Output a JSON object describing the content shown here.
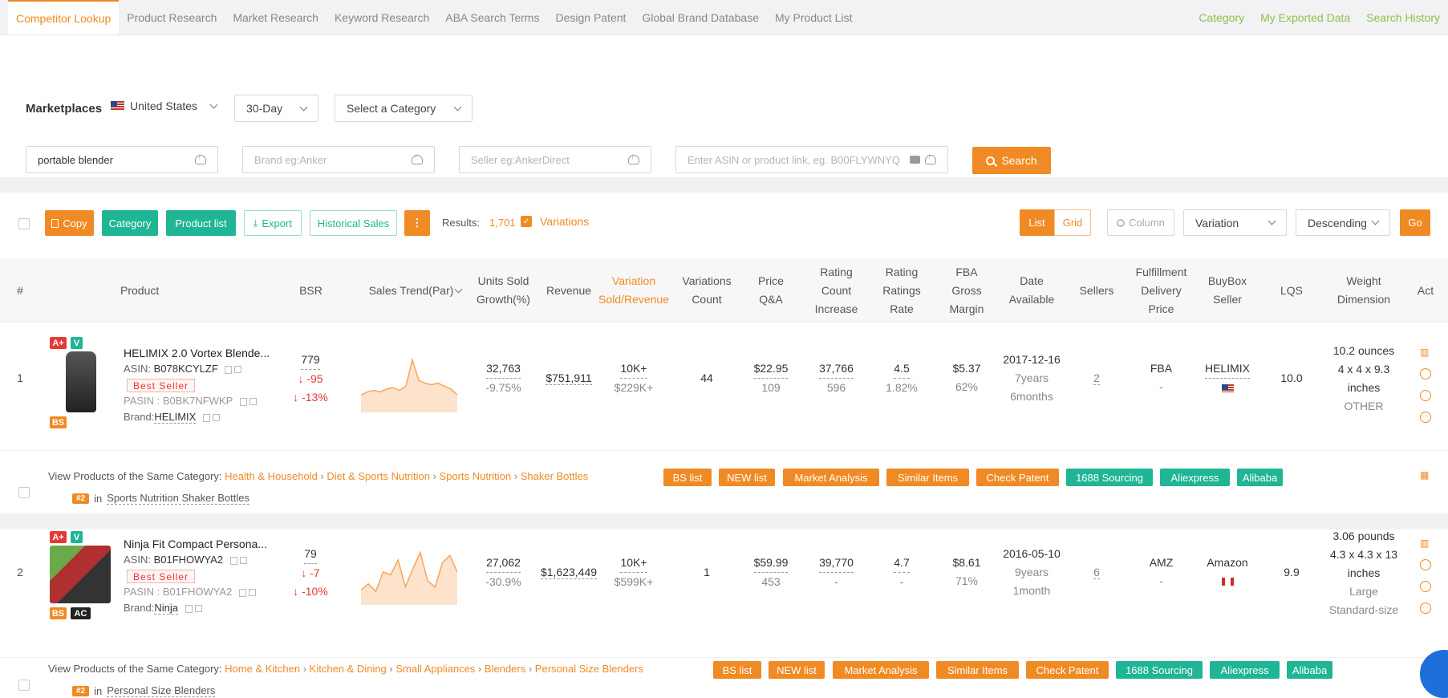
{
  "nav": {
    "tabs": [
      "Competitor Lookup",
      "Product Research",
      "Market Research",
      "Keyword Research",
      "ABA Search Terms",
      "Design Patent",
      "Global Brand Database",
      "My Product List"
    ],
    "right_tabs": [
      "Category",
      "My Exported Data",
      "Search History"
    ]
  },
  "search": {
    "marketplaces_label": "Marketplaces",
    "marketplace": "United States",
    "period": "30-Day",
    "category_placeholder": "Select a Category",
    "keyword_value": "portable blender",
    "brand_placeholder": "Brand eg:Anker",
    "seller_placeholder": "Seller eg:AnkerDirect",
    "asin_placeholder": "Enter ASIN or product link, eg. B00FLYWNYQ",
    "search_button": "Search"
  },
  "toolbar": {
    "copy": "Copy",
    "category": "Category",
    "product_list": "Product list",
    "export": "Export",
    "historical_sales": "Historical Sales",
    "results_label": "Results:",
    "results_count": "1,701",
    "variations": "Variations",
    "view_list": "List",
    "view_grid": "Grid",
    "column": "Column",
    "sort_field": "Variation",
    "sort_order": "Descending",
    "go": "Go"
  },
  "headers": {
    "idx": "#",
    "product": "Product",
    "bsr": "BSR",
    "sales_trend": "Sales Trend(Par)",
    "units": "Units Sold Growth(%)",
    "revenue": "Revenue",
    "variation": "Variation Sold/Revenue",
    "var_count": "Variations Count",
    "price": "Price Q&A",
    "rating_count": "Rating Count Increase",
    "rating": "Rating Ratings Rate",
    "fba": "FBA Gross Margin",
    "date": "Date Available",
    "sellers": "Sellers",
    "fulfillment": "Fulfillment Delivery Price",
    "buybox": "BuyBox Seller",
    "lqs": "LQS",
    "weight": "Weight Dimension",
    "act": "Act"
  },
  "rows": [
    {
      "idx": "1",
      "name": "HELIMIX 2.0 Vortex Blende...",
      "asin_label": "ASIN:",
      "asin": "B078KCYLZF",
      "best_seller": "Best Seller",
      "pasin": "PASIN : B0BK7NFWKP",
      "brand_label": "Brand:",
      "brand": "HELIMIX",
      "badges": [
        "A+",
        "V",
        "BS"
      ],
      "bsr": "779",
      "bsr_change": "↓ -95",
      "bsr_pct": "↓ -13%",
      "trend": [
        12,
        14,
        15,
        14,
        16,
        17,
        15,
        18,
        36,
        22,
        20,
        19,
        20,
        18,
        16,
        12
      ],
      "units": "32,763",
      "units_growth": "-9.75%",
      "revenue": "$751,911",
      "var_sold": "10K+",
      "var_rev": "$229K+",
      "var_count": "44",
      "price": "$22.95",
      "qa": "109",
      "rating_count": "37,766",
      "rating_inc": "596",
      "rating": "4.5",
      "rating_rate": "1.82%",
      "fba": "$5.37",
      "margin": "62%",
      "date": "2017-12-16",
      "age1": "7years",
      "age2": "6months",
      "sellers": "2",
      "fulfillment": "FBA",
      "delivery": "-",
      "buybox": "HELIMIX",
      "lqs": "10.0",
      "weight": "10.2 ounces",
      "dim1": "4 x 4 x 9.3",
      "dim2": "inches",
      "size": "OTHER",
      "cat_label": "View Products of the Same Category:",
      "crumbs": [
        "Health & Household",
        "Diet & Sports Nutrition",
        "Sports Nutrition",
        "Shaker Bottles"
      ],
      "rank": "#2",
      "rank_in": "in",
      "rank_cat": "Sports Nutrition Shaker Bottles"
    },
    {
      "idx": "2",
      "name": "Ninja Fit Compact Persona...",
      "asin_label": "ASIN:",
      "asin": "B01FHOWYA2",
      "best_seller": "Best Seller",
      "pasin": "PASIN : B01FHOWYA2",
      "brand_label": "Brand:",
      "brand": "Ninja",
      "badges": [
        "A+",
        "V",
        "BS",
        "AC"
      ],
      "bsr": "79",
      "bsr_change": "↓ -7",
      "bsr_pct": "↓ -10%",
      "trend": [
        10,
        14,
        9,
        22,
        20,
        30,
        12,
        24,
        35,
        16,
        12,
        28,
        33,
        22
      ],
      "units": "27,062",
      "units_growth": "-30.9%",
      "revenue": "$1,623,449",
      "var_sold": "10K+",
      "var_rev": "$599K+",
      "var_count": "1",
      "price": "$59.99",
      "qa": "453",
      "rating_count": "39,770",
      "rating_inc": "-",
      "rating": "4.7",
      "rating_rate": "-",
      "fba": "$8.61",
      "margin": "71%",
      "date": "2016-05-10",
      "age1": "9years",
      "age2": "1month",
      "sellers": "6",
      "fulfillment": "AMZ",
      "delivery": "-",
      "buybox": "Amazon",
      "lqs": "9.9",
      "weight": "3.06 pounds",
      "dim1": "4.3 x 4.3 x 13",
      "dim2": "inches",
      "size": "Large",
      "size2": "Standard-size",
      "cat_label": "View Products of the Same Category:",
      "crumbs": [
        "Home & Kitchen",
        "Kitchen & Dining",
        "Small Appliances",
        "Blenders",
        "Personal Size Blenders"
      ],
      "rank": "#2",
      "rank_in": "in",
      "rank_cat": "Personal Size Blenders"
    }
  ],
  "row_tags": [
    "BS list",
    "NEW list",
    "Market Analysis",
    "Similar Items",
    "Check Patent",
    "1688 Sourcing",
    "Aliexpress",
    "Alibaba"
  ],
  "colors": {
    "accent": "#f08a24",
    "teal": "#1fb595",
    "green_link": "#8bc34a",
    "danger": "#e53935"
  }
}
